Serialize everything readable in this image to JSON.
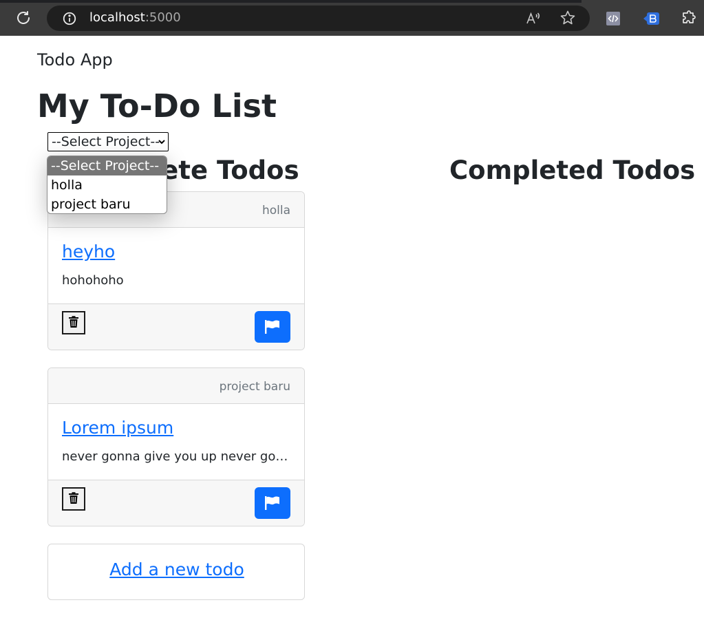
{
  "browser": {
    "url_host": "localhost",
    "url_port": ":5000"
  },
  "page": {
    "brand": "Todo App",
    "title": "My To-Do List",
    "project_select": {
      "selected": "--Select Project--",
      "options": [
        "--Select Project--",
        "holla",
        "project baru"
      ]
    },
    "incomplete_heading": "Incomplete Todos",
    "completed_heading": "Completed Todos",
    "todos": [
      {
        "project": "holla",
        "title": "heyho",
        "description": "hohohoho"
      },
      {
        "project": "project baru",
        "title": "Lorem ipsum",
        "description": "never gonna give you up never gonna let you down"
      }
    ],
    "add_link": "Add a new todo"
  },
  "colors": {
    "primary": "#0d6efd",
    "chrome": "#3b3b3b"
  },
  "icons": {
    "reload": "reload-icon",
    "info": "info-icon",
    "read_aloud": "read-aloud-icon",
    "favorite": "star-icon",
    "extensions": "puzzle-icon",
    "trash": "trash-icon",
    "flag": "flag-icon"
  }
}
